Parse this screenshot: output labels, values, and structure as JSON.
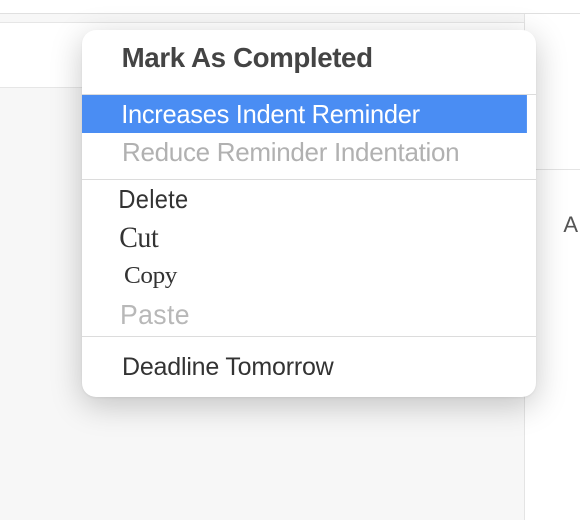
{
  "rightPanel": {
    "letter": "A"
  },
  "contextMenu": {
    "markCompleted": "Mark As Completed",
    "increaseIndent": "Increases Indent Reminder",
    "reduceIndent": "Reduce Reminder Indentation",
    "delete": "Delete",
    "cut": "Cut",
    "copy": "Copy",
    "paste": "Paste",
    "deadlineTomorrow": "Deadline Tomorrow"
  }
}
